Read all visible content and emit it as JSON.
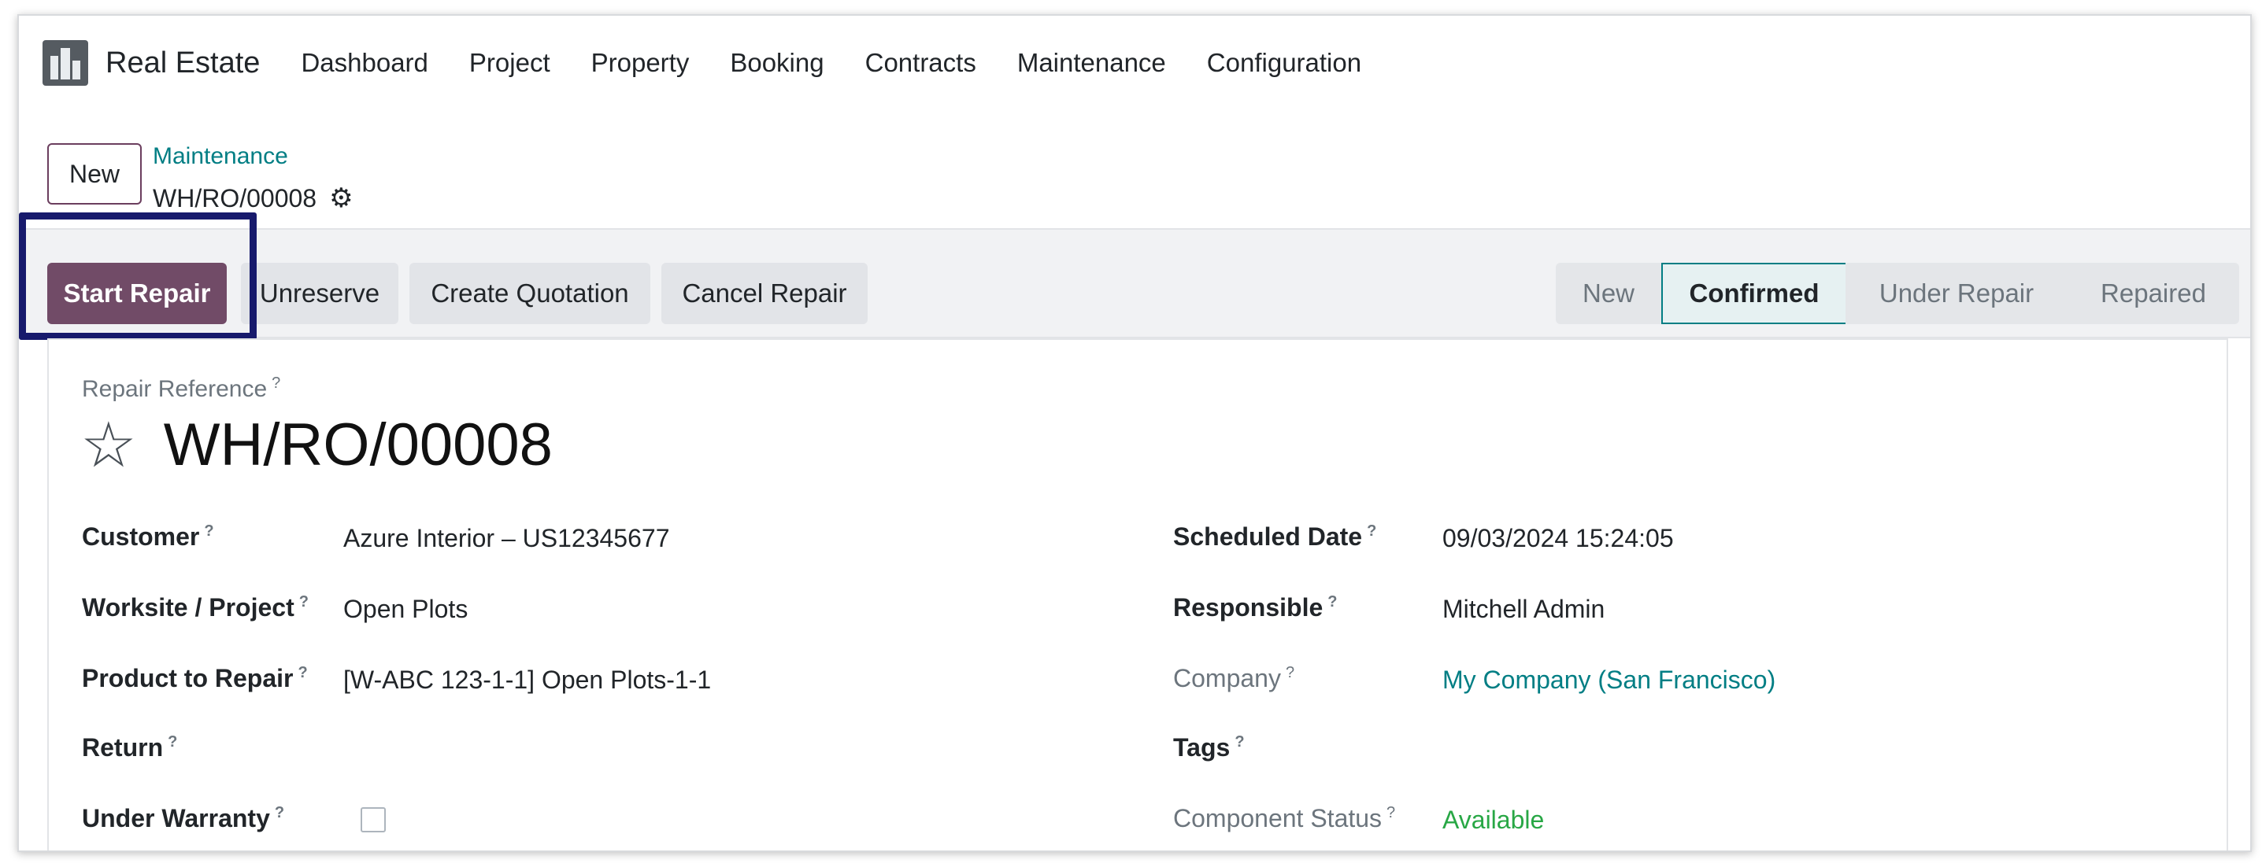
{
  "navbar": {
    "app_name": "Real Estate",
    "items": [
      "Dashboard",
      "Project",
      "Property",
      "Booking",
      "Contracts",
      "Maintenance",
      "Configuration"
    ]
  },
  "control": {
    "new_label": "New",
    "breadcrumb_parent": "Maintenance",
    "breadcrumb_current": "WH/RO/00008"
  },
  "actions": {
    "start_repair": "Start Repair",
    "unreserve": "Unreserve",
    "create_quotation": "Create Quotation",
    "cancel_repair": "Cancel Repair"
  },
  "stages": [
    "New",
    "Confirmed",
    "Under Repair",
    "Repaired"
  ],
  "form": {
    "reference_label": "Repair Reference",
    "title": "WH/RO/00008",
    "left": [
      {
        "label": "Customer",
        "value": "Azure Interior – US12345677"
      },
      {
        "label": "Worksite / Project",
        "value": "Open Plots"
      },
      {
        "label": "Product to Repair",
        "value": "[W-ABC 123-1-1] Open Plots-1-1"
      },
      {
        "label": "Return",
        "value": ""
      },
      {
        "label": "Under Warranty",
        "value": ""
      }
    ],
    "right": [
      {
        "label": "Scheduled Date",
        "value": "09/03/2024 15:24:05"
      },
      {
        "label": "Responsible",
        "value": "Mitchell Admin"
      },
      {
        "label": "Company",
        "value": "My Company (San Francisco)"
      },
      {
        "label": "Tags",
        "value": ""
      },
      {
        "label": "Component Status",
        "value": "Available"
      }
    ],
    "help_mark": "?"
  },
  "colors": {
    "primary": "#714b67",
    "link": "#017e84",
    "highlight": "#171a6c",
    "success": "#28a745"
  }
}
